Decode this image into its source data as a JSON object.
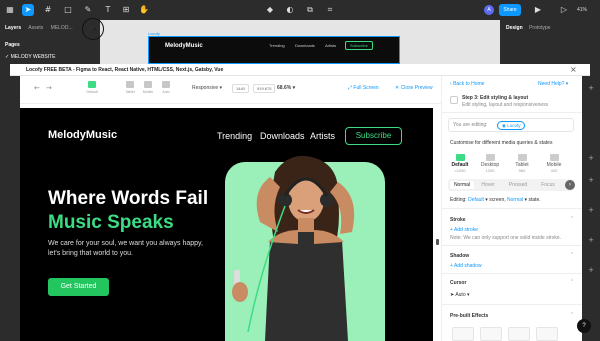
{
  "figma": {
    "share_label": "Share",
    "avatar_initial": "A",
    "zoom": "41%",
    "left_tabs": [
      "Layers",
      "Assets",
      "MELOD..."
    ],
    "pages_label": "Pages",
    "page_name": "MELODY WEBSITE",
    "right_tabs": [
      "Design",
      "Prototype"
    ],
    "frame_label": "Locofy"
  },
  "mini_site": {
    "logo": "MelodyMusic",
    "nav": [
      "Trending",
      "Downloads",
      "Artists"
    ],
    "subscribe": "Subscribe"
  },
  "plugin": {
    "title": "Locofy FREE BETA - Figma to React, React Native, HTML/CSS, Next.js, Gatsby, Vue",
    "close": "×"
  },
  "toolbar": {
    "devices": [
      "Default",
      "Tablet",
      "Mobile",
      "Auto"
    ],
    "responsive_label": "Responsive",
    "width_value": "1440",
    "height_value": "919.675",
    "zoom_value": "68.6%",
    "full_screen": "Full Screen",
    "close_preview": "Close Preview"
  },
  "preview": {
    "logo": "MelodyMusic",
    "nav": [
      "Trending",
      "Downloads",
      "Artists"
    ],
    "subscribe": "Subscribe",
    "headline_1": "Where Words Fail",
    "headline_2": "Music Speaks",
    "paragraph": "We care for your soul, we want you always happy, let's bring that world to you.",
    "cta": "Get Started"
  },
  "panel": {
    "back": "Back to Home",
    "need_help": "Need Help?",
    "step_label": "Step 3: Edit styling & layout",
    "step_sub": "Edit styling, layout and responsiveness",
    "editing_label": "You are editing:",
    "editing_value": "Locofy",
    "customise": "Customise for different media queries & states",
    "devices": [
      {
        "name": "Default",
        "px": ">1200"
      },
      {
        "name": "Desktop",
        "px": "1200"
      },
      {
        "name": "Tablet",
        "px": "960"
      },
      {
        "name": "Mobile",
        "px": "420"
      }
    ],
    "states": [
      "Normal",
      "Hover",
      "Pressed",
      "Focus"
    ],
    "editing_line_prefix": "Editing:",
    "editing_line_screen": "Default",
    "editing_line_mid": "screen,",
    "editing_line_state": "Normal",
    "editing_line_suffix": "state.",
    "stroke_title": "Stroke",
    "add_stroke": "+ Add stroke",
    "stroke_note": "Note: We can only support one solid inside stroke.",
    "shadow_title": "Shadow",
    "add_shadow": "+ Add shadow",
    "cursor_title": "Cursor",
    "cursor_value": "Auto",
    "effects_title": "Pre-built Effects",
    "help": "?"
  }
}
